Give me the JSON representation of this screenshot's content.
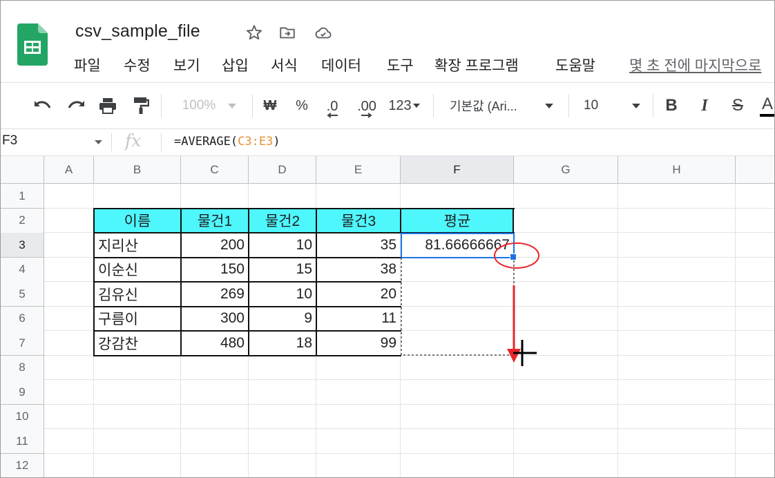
{
  "app": {
    "doc_title": "csv_sample_file",
    "icons": [
      "sheets-logo-icon",
      "star-icon",
      "move-to-folder-icon",
      "cloud-saved-icon"
    ]
  },
  "menu": {
    "items": [
      "파일",
      "수정",
      "보기",
      "삽입",
      "서식",
      "데이터",
      "도구",
      "확장 프로그램",
      "도움말"
    ],
    "last_edit": "몇 초 전에 마지막으로"
  },
  "toolbar": {
    "zoom": "100%",
    "currency": "₩",
    "percent": "%",
    "dec_decrease": ".0",
    "dec_increase": ".00",
    "format_more": "123",
    "font": "기본값 (Ari...",
    "font_size": "10",
    "bold": "B",
    "italic": "I",
    "strike": "S",
    "text_color": "A"
  },
  "formula_bar": {
    "name_box": "F3",
    "fx": "fx",
    "formula_prefix": "=AVERAGE(",
    "formula_ref": "C3:E3",
    "formula_suffix": ")"
  },
  "sheet": {
    "columns": [
      "A",
      "B",
      "C",
      "D",
      "E",
      "F",
      "G",
      "H"
    ],
    "rows": [
      "1",
      "2",
      "3",
      "4",
      "5",
      "6",
      "7",
      "8",
      "9",
      "10",
      "11",
      "12"
    ],
    "active_cell": "F3",
    "header_fill": "#4ef7fb",
    "table_header": [
      "이름",
      "물건1",
      "물건2",
      "물건3",
      "평균"
    ],
    "table_rows": [
      {
        "name": "지리산",
        "c": "200",
        "d": "10",
        "e": "35",
        "f": "81.66666667"
      },
      {
        "name": "이순신",
        "c": "150",
        "d": "15",
        "e": "38",
        "f": ""
      },
      {
        "name": "김유신",
        "c": "269",
        "d": "10",
        "e": "20",
        "f": ""
      },
      {
        "name": "구름이",
        "c": "300",
        "d": "9",
        "e": "11",
        "f": ""
      },
      {
        "name": "강감찬",
        "c": "480",
        "d": "18",
        "e": "99",
        "f": ""
      }
    ]
  },
  "annotations": {
    "highlight_color": "#e8252b",
    "items": [
      "red-circle-around-fill-handle",
      "red-down-arrow",
      "crosshair-cursor"
    ]
  }
}
